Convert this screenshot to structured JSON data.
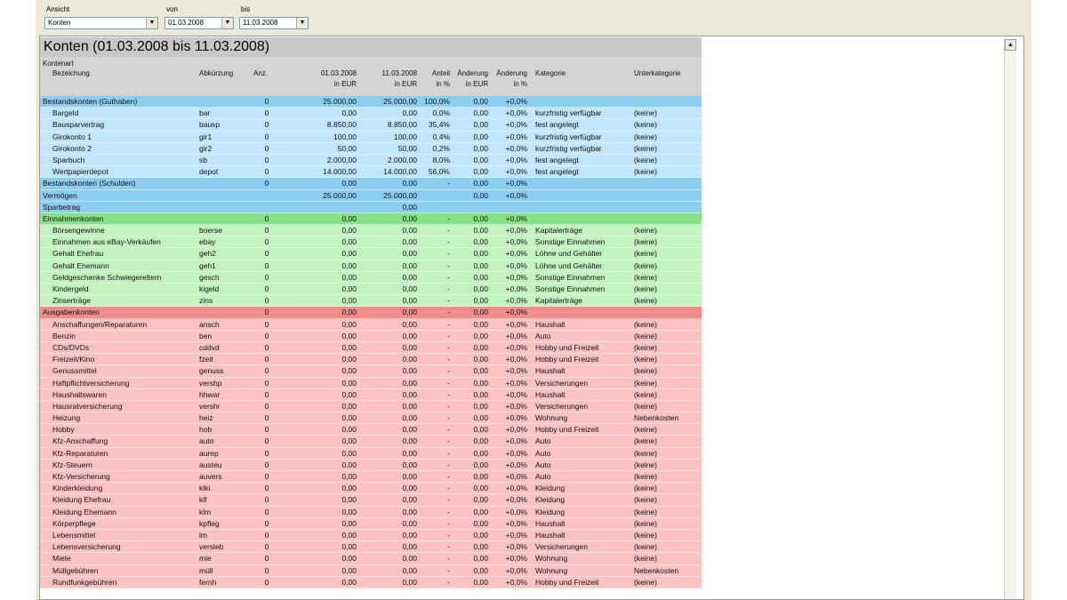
{
  "toolbar": {
    "view_label": "Ansicht",
    "view_value": "Konten",
    "from_label": "von",
    "from_value": "01.03.2008",
    "to_label": "bis",
    "to_value": "11.03.2008"
  },
  "report": {
    "title": "Konten (01.03.2008 bis 11.03.2008)",
    "headers": {
      "kontenart": "Kontenart",
      "bezeichnung": "Bezeichung",
      "abk": "Abkürzung",
      "anz": "Anz.",
      "d1_a": "01.03.2008",
      "d1_b": "in EUR",
      "d2_a": "11.03.2008",
      "d2_b": "in EUR",
      "anteil_a": "Anteil",
      "anteil_b": "in %",
      "aend_a": "Änderung",
      "aend_b": "in EUR",
      "aendp_a": "Änderung",
      "aendp_b": "in %",
      "kategorie": "Kategorie",
      "unterkategorie": "Unterkategorie"
    },
    "rows": [
      {
        "t": "group",
        "color": "blue",
        "cells": [
          "Bestandskonten (Guthaben)",
          "",
          "0",
          "25.000,00",
          "25.000,00",
          "100,0%",
          "0,00",
          "+0,0%",
          "",
          ""
        ]
      },
      {
        "t": "item",
        "color": "blue",
        "cells": [
          "Bargeld",
          "bar",
          "0",
          "0,00",
          "0,00",
          "0,0%",
          "0,00",
          "+0,0%",
          "kurzfristig verfügbar",
          "(keine)"
        ]
      },
      {
        "t": "item",
        "color": "blue",
        "cells": [
          "Bausparvertrag",
          "bausp",
          "0",
          "8.850,00",
          "8.850,00",
          "35,4%",
          "0,00",
          "+0,0%",
          "fest angelegt",
          "(keine)"
        ]
      },
      {
        "t": "item",
        "color": "blue",
        "cells": [
          "Girokonto 1",
          "gir1",
          "0",
          "100,00",
          "100,00",
          "0,4%",
          "0,00",
          "+0,0%",
          "kurzfristig verfügbar",
          "(keine)"
        ]
      },
      {
        "t": "item",
        "color": "blue",
        "cells": [
          "Girokonto 2",
          "gir2",
          "0",
          "50,00",
          "50,00",
          "0,2%",
          "0,00",
          "+0,0%",
          "kurzfristig verfügbar",
          "(keine)"
        ]
      },
      {
        "t": "item",
        "color": "blue",
        "cells": [
          "Sparbuch",
          "sb",
          "0",
          "2.000,00",
          "2.000,00",
          "8,0%",
          "0,00",
          "+0,0%",
          "fest angelegt",
          "(keine)"
        ]
      },
      {
        "t": "item",
        "color": "blue",
        "cells": [
          "Wertpapierdepot",
          "depot",
          "0",
          "14.000,00",
          "14.000,00",
          "56,0%",
          "0,00",
          "+0,0%",
          "fest angelegt",
          "(keine)"
        ]
      },
      {
        "t": "group",
        "color": "blue",
        "cells": [
          "Bestandskonten (Schulden)",
          "",
          "0",
          "0,00",
          "0,00",
          "-",
          "0,00",
          "+0,0%",
          "",
          ""
        ]
      },
      {
        "t": "group",
        "color": "blue",
        "cells": [
          "Vermögen",
          "",
          "",
          "25.000,00",
          "25.000,00",
          "",
          "0,00",
          "+0,0%",
          "",
          ""
        ]
      },
      {
        "t": "group",
        "color": "blue",
        "cells": [
          "Sparbetrag",
          "",
          "",
          "",
          "0,00",
          "",
          "",
          "",
          "",
          ""
        ]
      },
      {
        "t": "group",
        "color": "green",
        "cells": [
          "Einnahmenkonten",
          "",
          "0",
          "0,00",
          "0,00",
          "-",
          "0,00",
          "+0,0%",
          "",
          ""
        ]
      },
      {
        "t": "item",
        "color": "green",
        "cells": [
          "Börsengewinne",
          "boerse",
          "0",
          "0,00",
          "0,00",
          "-",
          "0,00",
          "+0,0%",
          "Kapitalerträge",
          "(keine)"
        ]
      },
      {
        "t": "item",
        "color": "green",
        "cells": [
          "Einnahmen aus eBay-Verkäufen",
          "ebay",
          "0",
          "0,00",
          "0,00",
          "-",
          "0,00",
          "+0,0%",
          "Sonstige Einnahmen",
          "(keine)"
        ]
      },
      {
        "t": "item",
        "color": "green",
        "cells": [
          "Gehalt Ehefrau",
          "geh2",
          "0",
          "0,00",
          "0,00",
          "-",
          "0,00",
          "+0,0%",
          "Löhne und Gehälter",
          "(keine)"
        ]
      },
      {
        "t": "item",
        "color": "green",
        "cells": [
          "Gehalt Ehemann",
          "geh1",
          "0",
          "0,00",
          "0,00",
          "-",
          "0,00",
          "+0,0%",
          "Löhne und Gehälter",
          "(keine)"
        ]
      },
      {
        "t": "item",
        "color": "green",
        "cells": [
          "Geldgeschenke Schwiegereltern",
          "gesch",
          "0",
          "0,00",
          "0,00",
          "-",
          "0,00",
          "+0,0%",
          "Sonstige Einnahmen",
          "(keine)"
        ]
      },
      {
        "t": "item",
        "color": "green",
        "cells": [
          "Kindergeld",
          "kigeld",
          "0",
          "0,00",
          "0,00",
          "-",
          "0,00",
          "+0,0%",
          "Sonstige Einnahmen",
          "(keine)"
        ]
      },
      {
        "t": "item",
        "color": "green",
        "cells": [
          "Zinserträge",
          "zins",
          "0",
          "0,00",
          "0,00",
          "-",
          "0,00",
          "+0,0%",
          "Kapitalerträge",
          "(keine)"
        ]
      },
      {
        "t": "group",
        "color": "red",
        "cells": [
          "Ausgabenkonten",
          "",
          "0",
          "0,00",
          "0,00",
          "-",
          "0,00",
          "+0,0%",
          "",
          ""
        ]
      },
      {
        "t": "item",
        "color": "red",
        "cells": [
          "Anschaffungen/Reparaturen",
          "ansch",
          "0",
          "0,00",
          "0,00",
          "-",
          "0,00",
          "+0,0%",
          "Haushalt",
          "(keine)"
        ]
      },
      {
        "t": "item",
        "color": "red",
        "cells": [
          "Benzin",
          "ben",
          "0",
          "0,00",
          "0,00",
          "-",
          "0,00",
          "+0,0%",
          "Auto",
          "(keine)"
        ]
      },
      {
        "t": "item",
        "color": "red",
        "cells": [
          "CDs/DVDs",
          "cddvd",
          "0",
          "0,00",
          "0,00",
          "-",
          "0,00",
          "+0,0%",
          "Hobby und Freizeit",
          "(keine)"
        ]
      },
      {
        "t": "item",
        "color": "red",
        "cells": [
          "Freizeit/Kino",
          "fzeit",
          "0",
          "0,00",
          "0,00",
          "-",
          "0,00",
          "+0,0%",
          "Hobby und Freizeit",
          "(keine)"
        ]
      },
      {
        "t": "item",
        "color": "red",
        "cells": [
          "Genussmittel",
          "genuss",
          "0",
          "0,00",
          "0,00",
          "-",
          "0,00",
          "+0,0%",
          "Haushalt",
          "(keine)"
        ]
      },
      {
        "t": "item",
        "color": "red",
        "cells": [
          "Haftpflichtversicherung",
          "vershp",
          "0",
          "0,00",
          "0,00",
          "-",
          "0,00",
          "+0,0%",
          "Versicherungen",
          "(keine)"
        ]
      },
      {
        "t": "item",
        "color": "red",
        "cells": [
          "Haushaltswaren",
          "hhwar",
          "0",
          "0,00",
          "0,00",
          "-",
          "0,00",
          "+0,0%",
          "Haushalt",
          "(keine)"
        ]
      },
      {
        "t": "item",
        "color": "red",
        "cells": [
          "Hausratversicherung",
          "vershr",
          "0",
          "0,00",
          "0,00",
          "-",
          "0,00",
          "+0,0%",
          "Versicherungen",
          "(keine)"
        ]
      },
      {
        "t": "item",
        "color": "red",
        "cells": [
          "Heizung",
          "heiz",
          "0",
          "0,00",
          "0,00",
          "-",
          "0,00",
          "+0,0%",
          "Wohnung",
          "Nebenkosten"
        ]
      },
      {
        "t": "item",
        "color": "red",
        "cells": [
          "Hobby",
          "hob",
          "0",
          "0,00",
          "0,00",
          "-",
          "0,00",
          "+0,0%",
          "Hobby und Freizeit",
          "(keine)"
        ]
      },
      {
        "t": "item",
        "color": "red",
        "cells": [
          "Kfz-Anschaffung",
          "auto",
          "0",
          "0,00",
          "0,00",
          "-",
          "0,00",
          "+0,0%",
          "Auto",
          "(keine)"
        ]
      },
      {
        "t": "item",
        "color": "red",
        "cells": [
          "Kfz-Reparaturen",
          "aurep",
          "0",
          "0,00",
          "0,00",
          "-",
          "0,00",
          "+0,0%",
          "Auto",
          "(keine)"
        ]
      },
      {
        "t": "item",
        "color": "red",
        "cells": [
          "Kfz-Steuern",
          "austeu",
          "0",
          "0,00",
          "0,00",
          "-",
          "0,00",
          "+0,0%",
          "Auto",
          "(keine)"
        ]
      },
      {
        "t": "item",
        "color": "red",
        "cells": [
          "Kfz-Versicherung",
          "auvers",
          "0",
          "0,00",
          "0,00",
          "-",
          "0,00",
          "+0,0%",
          "Auto",
          "(keine)"
        ]
      },
      {
        "t": "item",
        "color": "red",
        "cells": [
          "Kinderkleidung",
          "klki",
          "0",
          "0,00",
          "0,00",
          "-",
          "0,00",
          "+0,0%",
          "Kleidung",
          "(keine)"
        ]
      },
      {
        "t": "item",
        "color": "red",
        "cells": [
          "Kleidung Ehefrau",
          "klf",
          "0",
          "0,00",
          "0,00",
          "-",
          "0,00",
          "+0,0%",
          "Kleidung",
          "(keine)"
        ]
      },
      {
        "t": "item",
        "color": "red",
        "cells": [
          "Kleidung Ehemann",
          "klm",
          "0",
          "0,00",
          "0,00",
          "-",
          "0,00",
          "+0,0%",
          "Kleidung",
          "(keine)"
        ]
      },
      {
        "t": "item",
        "color": "red",
        "cells": [
          "Körperpflege",
          "kpfleg",
          "0",
          "0,00",
          "0,00",
          "-",
          "0,00",
          "+0,0%",
          "Haushalt",
          "(keine)"
        ]
      },
      {
        "t": "item",
        "color": "red",
        "cells": [
          "Lebensmittel",
          "lm",
          "0",
          "0,00",
          "0,00",
          "-",
          "0,00",
          "+0,0%",
          "Haushalt",
          "(keine)"
        ]
      },
      {
        "t": "item",
        "color": "red",
        "cells": [
          "Lebensversicherung",
          "versleb",
          "0",
          "0,00",
          "0,00",
          "-",
          "0,00",
          "+0,0%",
          "Versicherungen",
          "(keine)"
        ]
      },
      {
        "t": "item",
        "color": "red",
        "cells": [
          "Miete",
          "mie",
          "0",
          "0,00",
          "0,00",
          "-",
          "0,00",
          "+0,0%",
          "Wohnung",
          "(keine)"
        ]
      },
      {
        "t": "item",
        "color": "red",
        "cells": [
          "Müllgebühren",
          "müll",
          "0",
          "0,00",
          "0,00",
          "-",
          "0,00",
          "+0,0%",
          "Wohnung",
          "Nebenkosten"
        ]
      },
      {
        "t": "item",
        "color": "red",
        "cells": [
          "Rundfunkgebühren",
          "fernh",
          "0",
          "0,00",
          "0,00",
          "-",
          "0,00",
          "+0,0%",
          "Hobby und Freizeit",
          "(keine)"
        ]
      }
    ]
  },
  "icons": {
    "dropdown": "chevron-down-icon",
    "scroll_up": "arrow-up-icon"
  }
}
